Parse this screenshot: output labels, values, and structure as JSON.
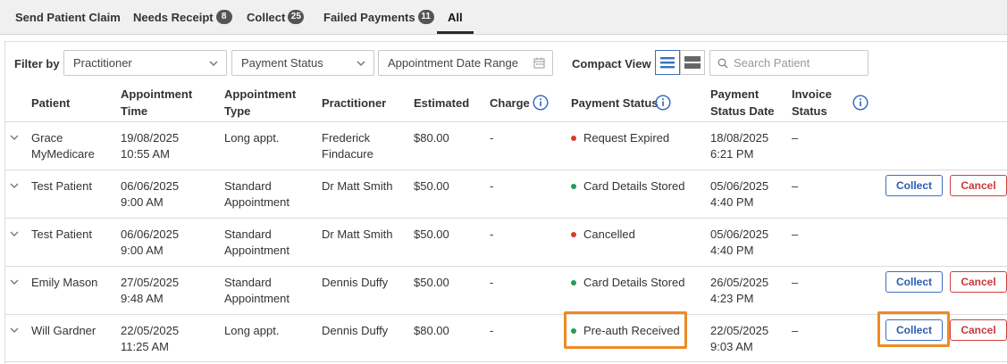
{
  "tabs": [
    {
      "label": "Send Patient Claim",
      "badge": ""
    },
    {
      "label": "Needs Receipt",
      "badge": "8"
    },
    {
      "label": "Collect",
      "badge": "25"
    },
    {
      "label": "Failed Payments",
      "badge": "11"
    },
    {
      "label": "All",
      "badge": ""
    }
  ],
  "filters": {
    "label": "Filter by",
    "practitioner": "Practitioner",
    "payment_status": "Payment Status",
    "date_range": "Appointment Date Range",
    "compact_label": "Compact View",
    "search_placeholder": "Search Patient"
  },
  "columns": {
    "patient": "Patient",
    "appt_time_1": "Appointment",
    "appt_time_2": "Time",
    "appt_type_1": "Appointment",
    "appt_type_2": "Type",
    "practitioner": "Practitioner",
    "estimated": "Estimated",
    "charge": "Charge",
    "payment_status": "Payment Status",
    "status_date_1": "Payment",
    "status_date_2": "Status Date",
    "invoice_1": "Invoice",
    "invoice_2": "Status"
  },
  "actions": {
    "collect": "Collect",
    "cancel": "Cancel"
  },
  "colors": {
    "red_dot": "#d43f2a",
    "green_dot": "#1e9e5a",
    "accent": "#3a6fc0",
    "highlight": "#f08a24"
  },
  "rows": [
    {
      "patient_1": "Grace",
      "patient_2": "MyMedicare",
      "time_1": "19/08/2025",
      "time_2": "10:55 AM",
      "type_1": "Long appt.",
      "type_2": "",
      "prac_1": "Frederick",
      "prac_2": "Findacure",
      "estimated": "$80.00",
      "charge": "-",
      "status": "Request Expired",
      "status_color": "red",
      "date_1": "18/08/2025",
      "date_2": "6:21 PM",
      "invoice": "–",
      "actions": false
    },
    {
      "patient_1": "Test Patient",
      "patient_2": "",
      "time_1": "06/06/2025",
      "time_2": "9:00 AM",
      "type_1": "Standard",
      "type_2": "Appointment",
      "prac_1": "Dr Matt Smith",
      "prac_2": "",
      "estimated": "$50.00",
      "charge": "-",
      "status": "Card Details Stored",
      "status_color": "green",
      "date_1": "05/06/2025",
      "date_2": "4:40 PM",
      "invoice": "–",
      "actions": true
    },
    {
      "patient_1": "Test Patient",
      "patient_2": "",
      "time_1": "06/06/2025",
      "time_2": "9:00 AM",
      "type_1": "Standard",
      "type_2": "Appointment",
      "prac_1": "Dr Matt Smith",
      "prac_2": "",
      "estimated": "$50.00",
      "charge": "-",
      "status": "Cancelled",
      "status_color": "red",
      "date_1": "05/06/2025",
      "date_2": "4:40 PM",
      "invoice": "–",
      "actions": false
    },
    {
      "patient_1": "Emily Mason",
      "patient_2": "",
      "time_1": "27/05/2025",
      "time_2": "9:48 AM",
      "type_1": "Standard",
      "type_2": "Appointment",
      "prac_1": "Dennis Duffy",
      "prac_2": "",
      "estimated": "$50.00",
      "charge": "-",
      "status": "Card Details Stored",
      "status_color": "green",
      "date_1": "26/05/2025",
      "date_2": "4:23 PM",
      "invoice": "–",
      "actions": true
    },
    {
      "patient_1": "Will Gardner",
      "patient_2": "",
      "time_1": "22/05/2025",
      "time_2": "11:25 AM",
      "type_1": "Long appt.",
      "type_2": "",
      "prac_1": "Dennis Duffy",
      "prac_2": "",
      "estimated": "$80.00",
      "charge": "-",
      "status": "Pre-auth Received",
      "status_color": "green",
      "date_1": "22/05/2025",
      "date_2": "9:03 AM",
      "invoice": "–",
      "actions": true
    }
  ]
}
